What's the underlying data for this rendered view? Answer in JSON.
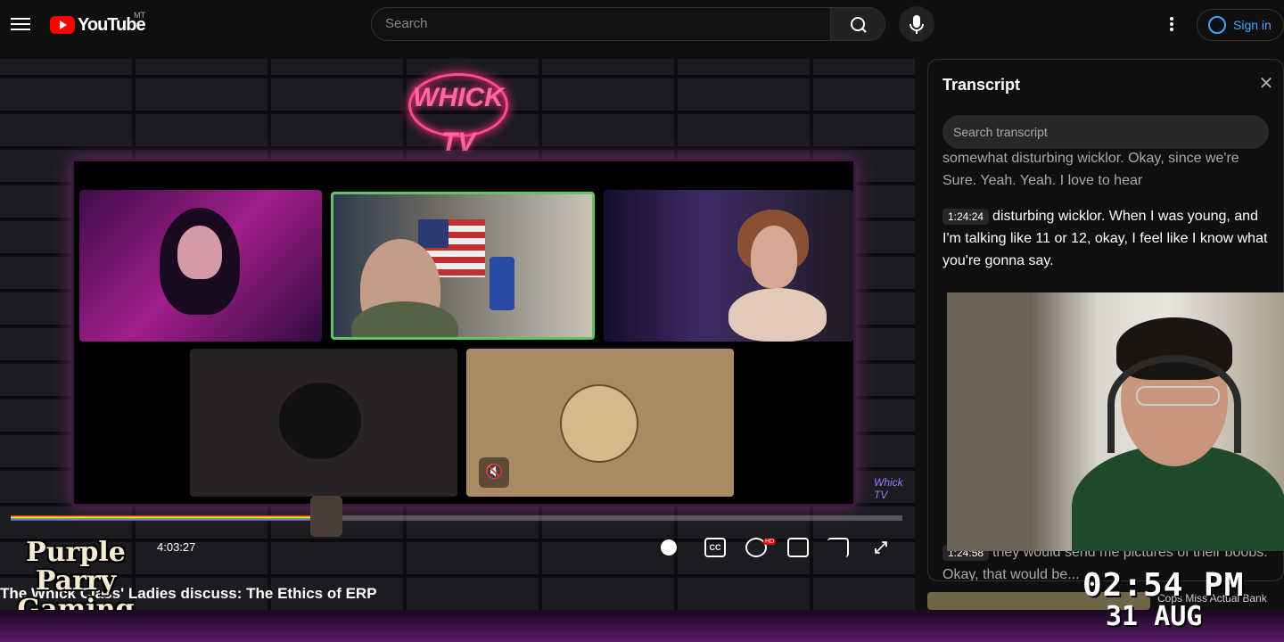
{
  "header": {
    "logo_text": "YouTube",
    "region": "MT",
    "search_placeholder": "Search",
    "signin_label": "Sign in"
  },
  "player": {
    "neon_logo": "WHICK TV",
    "elapsed": "4:03:27",
    "title": "The Whick Class' Ladies discuss: The Ethics of ERP",
    "progress_fraction": 0.34,
    "watermark": "Whick TV"
  },
  "overlay": {
    "channel_art": "Purple Parry Gaming"
  },
  "transcript": {
    "title": "Transcript",
    "search_placeholder": "Search transcript",
    "segments": [
      {
        "time": "",
        "text": "somewhat disturbing wicklor. Okay, since we're Sure. Yeah. Yeah. I love to hear"
      },
      {
        "time": "1:24:24",
        "text": "disturbing wicklor. When I was young, and I'm talking like 11 or 12, okay, I feel like I know what you're gonna say."
      },
      {
        "time": "1:24:58",
        "text": "they would send me pictures of their boobs. Okay, that would be..."
      }
    ]
  },
  "stream_overlay": {
    "time": "02:54 PM",
    "date": "31 AUG",
    "next_label": "Cops Miss Actual Bank"
  },
  "icons": [
    "menu-icon",
    "search-icon",
    "mic-icon",
    "more-icon",
    "account-icon",
    "close-icon",
    "pause-icon",
    "cc-icon",
    "settings-icon",
    "theater-icon",
    "cast-icon",
    "fullscreen-icon",
    "mic-muted-icon"
  ]
}
